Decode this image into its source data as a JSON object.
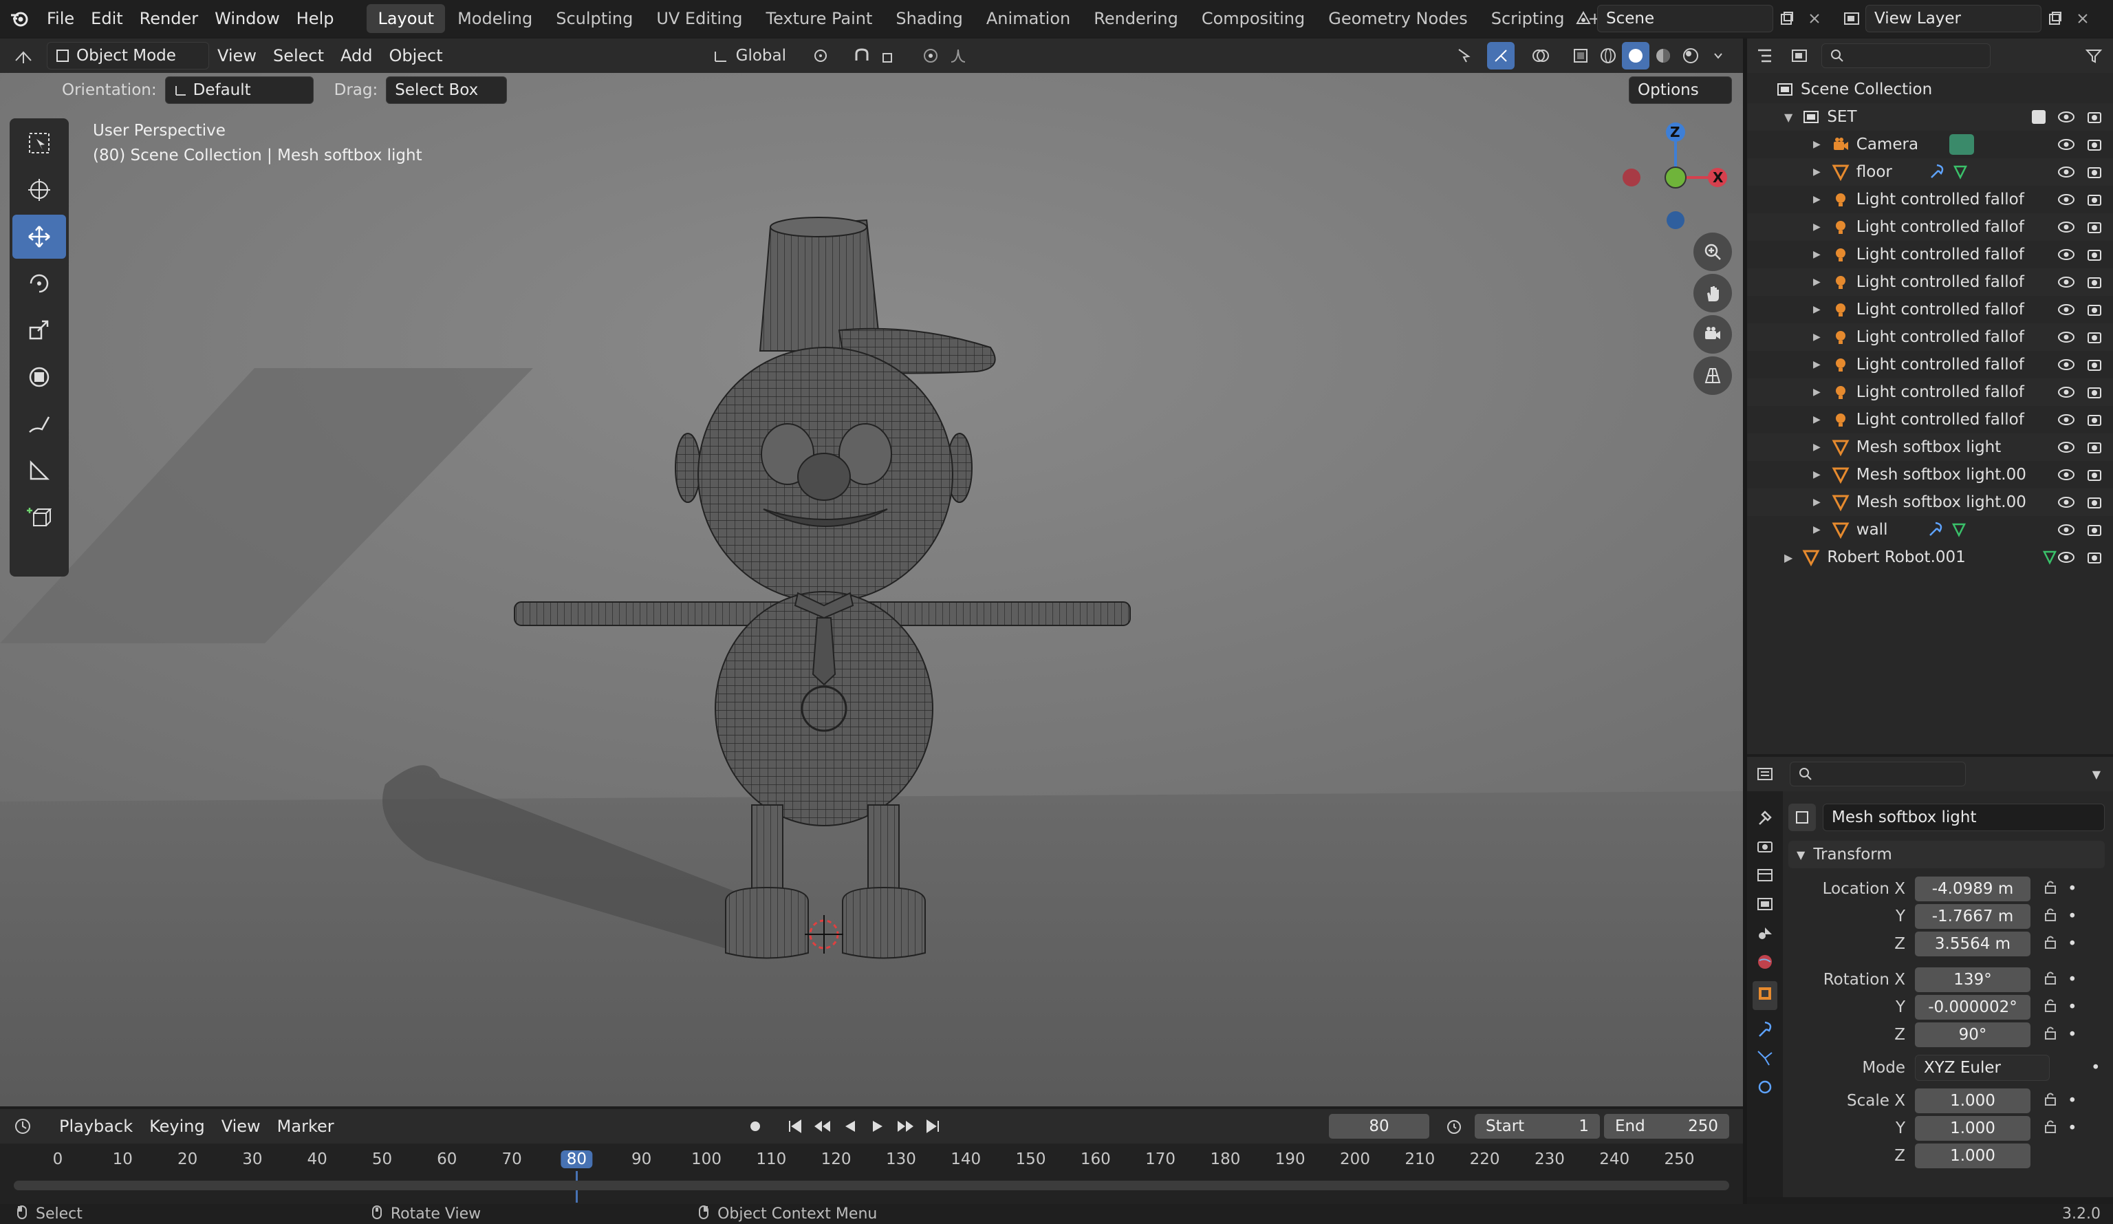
{
  "topbar": {
    "menus": [
      "File",
      "Edit",
      "Render",
      "Window",
      "Help"
    ],
    "workspaces": [
      "Layout",
      "Modeling",
      "Sculpting",
      "UV Editing",
      "Texture Paint",
      "Shading",
      "Animation",
      "Rendering",
      "Compositing",
      "Geometry Nodes",
      "Scripting"
    ],
    "active_workspace": "Layout",
    "add_tab": "+",
    "scene": "Scene",
    "view_layer": "View Layer"
  },
  "viewport_header": {
    "mode": "Object Mode",
    "menus": [
      "View",
      "Select",
      "Add",
      "Object"
    ],
    "transform_orientation": "Global",
    "options": "Options",
    "orientation_label": "Orientation:",
    "orientation_value": "Default",
    "drag_label": "Drag:",
    "drag_value": "Select Box"
  },
  "viewport": {
    "perspective": "User Perspective",
    "info": "(80) Scene Collection | Mesh softbox light",
    "gizmo": {
      "z": "Z",
      "x": "X"
    }
  },
  "outliner": {
    "root": "Scene Collection",
    "collection": "SET",
    "items": [
      {
        "name": "Camera",
        "icon": "camera-icon"
      },
      {
        "name": "floor",
        "icon": "mesh-icon"
      },
      {
        "name": "Light controlled fallof",
        "icon": "light-icon"
      },
      {
        "name": "Light controlled fallof",
        "icon": "light-icon"
      },
      {
        "name": "Light controlled fallof",
        "icon": "light-icon"
      },
      {
        "name": "Light controlled fallof",
        "icon": "light-icon"
      },
      {
        "name": "Light controlled fallof",
        "icon": "light-icon"
      },
      {
        "name": "Light controlled fallof",
        "icon": "light-icon"
      },
      {
        "name": "Light controlled fallof",
        "icon": "light-icon"
      },
      {
        "name": "Light controlled fallof",
        "icon": "light-icon"
      },
      {
        "name": "Light controlled fallof",
        "icon": "light-icon"
      },
      {
        "name": "Mesh softbox light",
        "icon": "mesh-icon"
      },
      {
        "name": "Mesh softbox light.00",
        "icon": "mesh-icon"
      },
      {
        "name": "Mesh softbox light.00",
        "icon": "mesh-icon"
      },
      {
        "name": "wall",
        "icon": "mesh-icon"
      }
    ],
    "root_item": "Robert Robot.001"
  },
  "properties": {
    "object_name": "Mesh softbox light",
    "section": "Transform",
    "location": {
      "label": "Location X",
      "x": "-4.0989 m",
      "y": "-1.7667 m",
      "z": "3.5564 m"
    },
    "rotation": {
      "label": "Rotation X",
      "x": "139°",
      "y": "-0.000002°",
      "z": "90°"
    },
    "mode_label": "Mode",
    "mode": "XYZ Euler",
    "scale": {
      "label": "Scale X",
      "x": "1.000",
      "y": "1.000",
      "z": "1.000"
    },
    "axis_y": "Y",
    "axis_z": "Z"
  },
  "timeline": {
    "menus": [
      "Playback",
      "Keying",
      "View",
      "Marker"
    ],
    "current_frame": "80",
    "start_label": "Start",
    "start": "1",
    "end_label": "End",
    "end": "250",
    "ticks": [
      "0",
      "10",
      "20",
      "30",
      "40",
      "50",
      "60",
      "70",
      "80",
      "90",
      "100",
      "110",
      "120",
      "130",
      "140",
      "150",
      "160",
      "170",
      "180",
      "190",
      "200",
      "210",
      "220",
      "230",
      "240",
      "250"
    ]
  },
  "statusbar": {
    "select": "Select",
    "rotate": "Rotate View",
    "context": "Object Context Menu",
    "version": "3.2.0"
  }
}
